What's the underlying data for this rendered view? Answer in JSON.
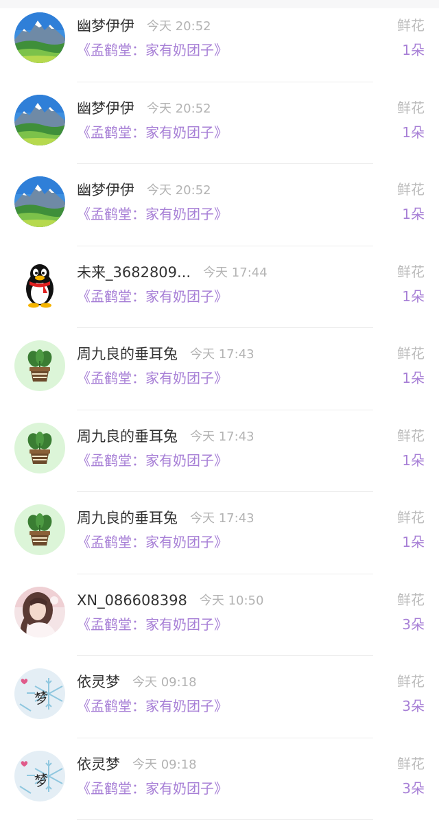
{
  "colors": {
    "name": "#333333",
    "time": "#b3b3b3",
    "accent_purple": "#a77fd6",
    "gift_label": "#bbbbbb"
  },
  "records": [
    {
      "avatar": "mountain-landscape-avatar",
      "name": "幽梦伊伊",
      "time": "今天 20:52",
      "book": "《孟鹤堂：家有奶团子》",
      "gift": "鲜花",
      "count": "1朵"
    },
    {
      "avatar": "mountain-landscape-avatar",
      "name": "幽梦伊伊",
      "time": "今天 20:52",
      "book": "《孟鹤堂：家有奶团子》",
      "gift": "鲜花",
      "count": "1朵"
    },
    {
      "avatar": "mountain-landscape-avatar",
      "name": "幽梦伊伊",
      "time": "今天 20:52",
      "book": "《孟鹤堂：家有奶团子》",
      "gift": "鲜花",
      "count": "1朵"
    },
    {
      "avatar": "qq-penguin-avatar",
      "name": "未来_3682809...",
      "time": "今天 17:44",
      "book": "《孟鹤堂：家有奶团子》",
      "gift": "鲜花",
      "count": "1朵"
    },
    {
      "avatar": "potted-plant-avatar",
      "name": "周九良的垂耳兔",
      "time": "今天 17:43",
      "book": "《孟鹤堂：家有奶团子》",
      "gift": "鲜花",
      "count": "1朵"
    },
    {
      "avatar": "potted-plant-avatar",
      "name": "周九良的垂耳兔",
      "time": "今天 17:43",
      "book": "《孟鹤堂：家有奶团子》",
      "gift": "鲜花",
      "count": "1朵"
    },
    {
      "avatar": "potted-plant-avatar",
      "name": "周九良的垂耳兔",
      "time": "今天 17:43",
      "book": "《孟鹤堂：家有奶团子》",
      "gift": "鲜花",
      "count": "1朵"
    },
    {
      "avatar": "girl-photo-avatar",
      "name": "XN_086608398",
      "time": "今天 10:50",
      "book": "《孟鹤堂：家有奶团子》",
      "gift": "鲜花",
      "count": "3朵"
    },
    {
      "avatar": "snowflake-meng-avatar",
      "name": "依灵梦",
      "time": "今天 09:18",
      "book": "《孟鹤堂：家有奶团子》",
      "gift": "鲜花",
      "count": "3朵"
    },
    {
      "avatar": "snowflake-meng-avatar",
      "name": "依灵梦",
      "time": "今天 09:18",
      "book": "《孟鹤堂：家有奶团子》",
      "gift": "鲜花",
      "count": "3朵"
    }
  ],
  "avatar_glyphs": {
    "snowflake": "梦"
  }
}
